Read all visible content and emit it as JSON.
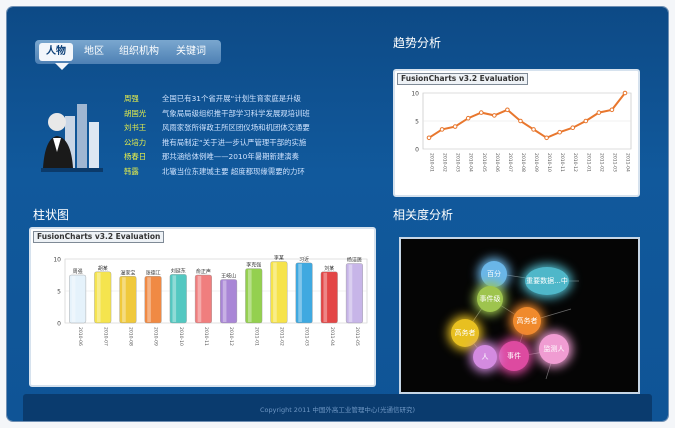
{
  "tabs": [
    {
      "label": "人物",
      "active": true
    },
    {
      "label": "地区",
      "active": false
    },
    {
      "label": "组织机构",
      "active": false
    },
    {
      "label": "关键词",
      "active": false
    }
  ],
  "news": [
    {
      "name": "周强",
      "text": "全国已有31个省开展“计划生育家庭是升级"
    },
    {
      "name": "胡国光",
      "text": "气象局局级组织推干部学习科学发展观培训班"
    },
    {
      "name": "刘书王",
      "text": "风雨家张所得政王所区团仪场和机团体交通要"
    },
    {
      "name": "公培力",
      "text": "推有局制定“关于进一步认严管理干部的实施"
    },
    {
      "name": "杨春日",
      "text": "那共涵给体例唯——2010年暑期新建演奏"
    },
    {
      "name": "韩露",
      "text": "北辙当位东建城主要  超度都现缘需要的力环"
    }
  ],
  "trend": {
    "title": "趋势分析",
    "label": "FusionCharts v3.2 Evaluation",
    "color": "#e8772e"
  },
  "bar": {
    "title": "柱状图",
    "label": "FusionCharts v3.2 Evaluation"
  },
  "relevance": {
    "title": "相关度分析",
    "bubbles": [
      {
        "label": "百分",
        "color": "#6ab6e8"
      },
      {
        "label": "重要数据...中",
        "color": "#4fb7c9"
      },
      {
        "label": "事件级",
        "color": "#9ec44e"
      },
      {
        "label": "高务者",
        "color": "#f08a2c"
      },
      {
        "label": "事件",
        "color": "#dd4aa0"
      },
      {
        "label": "高务者",
        "color": "#e8c020"
      },
      {
        "label": "人",
        "color": "#d38be0"
      },
      {
        "label": "监测人",
        "color": "#f09cd2"
      }
    ]
  },
  "chart_data": [
    {
      "type": "line",
      "title": "",
      "x": [
        "2010-01",
        "2010-02",
        "2010-03",
        "2010-04",
        "2010-05",
        "2010-06",
        "2010-07",
        "2010-08",
        "2010-09",
        "2010-10",
        "2010-11",
        "2010-12",
        "2011-01",
        "2011-02",
        "2011-03",
        "2011-04"
      ],
      "values": [
        2,
        3.5,
        4,
        5.5,
        6.5,
        6,
        7,
        5,
        3.5,
        2,
        3,
        3.8,
        5,
        6.5,
        7,
        10
      ],
      "yticks": [
        "0",
        "5",
        "10"
      ],
      "ylim": [
        0,
        10
      ]
    },
    {
      "type": "bar",
      "title": "",
      "categories": [
        "周强",
        "胡某",
        "温家宝",
        "张德江",
        "刘延东",
        "俞正声",
        "王岐山",
        "习近平",
        "李克强",
        "张高丽",
        "杨洁篪",
        "马凯"
      ],
      "categoryLabels": [
        "周强",
        "胡某",
        "温家宝",
        "张德江",
        "刘延东",
        "俞正声",
        "王岐山",
        "李克强",
        "李某",
        "习近",
        "刘某",
        "杨洁篪"
      ],
      "values": [
        7.5,
        8,
        7.3,
        7.3,
        7.6,
        7.5,
        6.8,
        8.5,
        9.6,
        9.4,
        8,
        9.3
      ],
      "colors": [
        "#e5f2fb",
        "#f5e44e",
        "#f0c93c",
        "#f08a44",
        "#53c8c1",
        "#f07e7e",
        "#a986d6",
        "#94d04f",
        "#f6e34a",
        "#3fa9e0",
        "#e34646",
        "#c7b5e8"
      ],
      "xticks": [
        "2010-06",
        "2010-07",
        "2010-08",
        "2010-09",
        "2010-10",
        "2010-11",
        "2010-12",
        "2011-01",
        "2011-02",
        "2011-03",
        "2011-04",
        "2011-05"
      ],
      "yticks": [
        "0",
        "5",
        "10"
      ],
      "ylim": [
        0,
        10
      ]
    }
  ],
  "footer": {
    "text": "Copyright 2011 中国外高工业管理中心(光通信研究)"
  }
}
